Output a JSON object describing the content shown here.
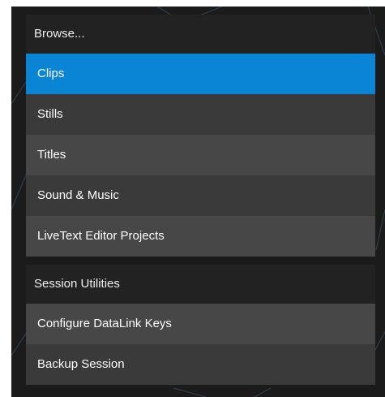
{
  "browse": {
    "header": "Browse...",
    "items": [
      {
        "label": "Clips"
      },
      {
        "label": "Stills"
      },
      {
        "label": "Titles"
      },
      {
        "label": "Sound & Music"
      },
      {
        "label": "LiveText Editor Projects"
      }
    ],
    "selected_index": 0
  },
  "utilities": {
    "header": "Session Utilities",
    "items": [
      {
        "label": "Configure DataLink Keys"
      },
      {
        "label": "Backup Session"
      }
    ]
  },
  "colors": {
    "selected": "#0a84d4",
    "item_dark": "#3a3a3a",
    "item_light": "#474747",
    "header_bg": "#222222",
    "backdrop": "#1b1b1b"
  }
}
